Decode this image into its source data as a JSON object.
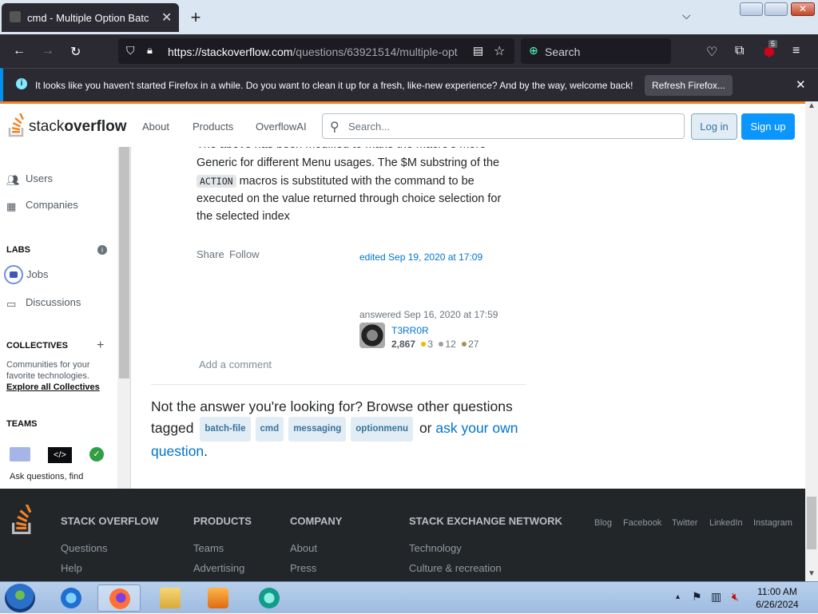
{
  "browser": {
    "tab_title": "cmd - Multiple Option Batch File",
    "url_main": "https://stackoverflow.com",
    "url_path": "/questions/63921514/multiple-opt",
    "search_placeholder": "Search",
    "extension_badge": "5",
    "notification_message": "It looks like you haven't started Firefox in a while. Do you want to clean it up for a fresh, like-new experience? And by the way, welcome back!",
    "notification_button": "Refresh Firefox..."
  },
  "so_header": {
    "logo_light": "stack",
    "logo_bold": "overflow",
    "nav": [
      "About",
      "Products",
      "OverflowAI"
    ],
    "search_placeholder": "Search...",
    "login": "Log in",
    "signup": "Sign up"
  },
  "sidebar": {
    "users": "Users",
    "companies": "Companies",
    "labs_heading": "LABS",
    "jobs": "Jobs",
    "discussions": "Discussions",
    "collectives_heading": "COLLECTIVES",
    "collectives_desc": "Communities for your favorite technologies.",
    "collectives_link": "Explore all Collectives",
    "teams_heading": "TEAMS",
    "teams_desc": "Ask questions, find"
  },
  "post": {
    "text_line0": "The above has been modified to make the macro's more",
    "text_line1": "Generic for different Menu usages. The $M substring of the",
    "code_action": "ACTION",
    "text_line2_rest": " macros is substituted with the command to be",
    "text_line3": "executed on the value returned through choice selection for",
    "text_line4": "the selected index",
    "share": "Share",
    "follow": "Follow",
    "edited": "edited Sep 19, 2020 at 17:09",
    "answered": "answered Sep 16, 2020 at 17:59",
    "user_name": "T3RR0R",
    "reputation": "2,867",
    "gold": "3",
    "silver": "12",
    "bronze": "27",
    "add_comment": "Add a comment"
  },
  "not_answer": {
    "prefix": "Not the answer you're looking for? Browse other questions tagged",
    "tags": [
      "batch-file",
      "cmd",
      "messaging",
      "optionmenu"
    ],
    "or": "or",
    "ask_link": "ask your own question",
    "suffix": "."
  },
  "footer": {
    "col1_head": "STACK OVERFLOW",
    "col1_links": [
      "Questions",
      "Help"
    ],
    "col2_head": "PRODUCTS",
    "col2_links": [
      "Teams",
      "Advertising"
    ],
    "col3_head": "COMPANY",
    "col3_links": [
      "About",
      "Press"
    ],
    "col4_head": "STACK EXCHANGE NETWORK",
    "col4_links": [
      "Technology",
      "Culture & recreation"
    ],
    "social": [
      "Blog",
      "Facebook",
      "Twitter",
      "LinkedIn",
      "Instagram"
    ]
  },
  "taskbar": {
    "time": "11:00 AM",
    "date": "6/26/2024"
  },
  "colors": {
    "so_orange": "#f48225",
    "so_blue": "#0a95ff",
    "gold": "#f1b600",
    "silver": "#9a9fa4",
    "bronze": "#ab8a5f"
  }
}
